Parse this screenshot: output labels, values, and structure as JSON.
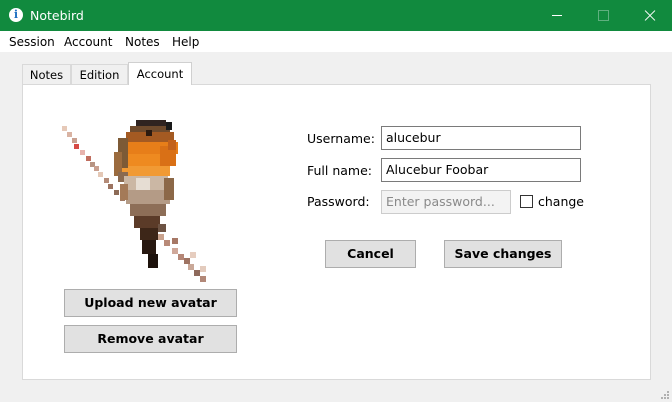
{
  "window": {
    "title": "Notebird",
    "app_icon_glyph": "i",
    "title_bar_color": "#118a3e"
  },
  "menu": {
    "items": [
      {
        "label": "Session"
      },
      {
        "label": "Account"
      },
      {
        "label": "Notes"
      },
      {
        "label": "Help"
      }
    ]
  },
  "tabs": {
    "items": [
      {
        "label": "Notes"
      },
      {
        "label": "Edition"
      },
      {
        "label": "Account"
      }
    ],
    "active": "Account"
  },
  "account": {
    "avatar_icon": "robin-bird-pixel-art",
    "upload_label": "Upload new avatar",
    "remove_label": "Remove avatar",
    "username_label": "Username:",
    "username_value": "alucebur",
    "fullname_label": "Full name:",
    "fullname_value": "Alucebur Foobar",
    "password_label": "Password:",
    "password_placeholder": "Enter password...",
    "change_label": "change",
    "change_checked": false,
    "cancel_label": "Cancel",
    "save_label": "Save changes"
  }
}
